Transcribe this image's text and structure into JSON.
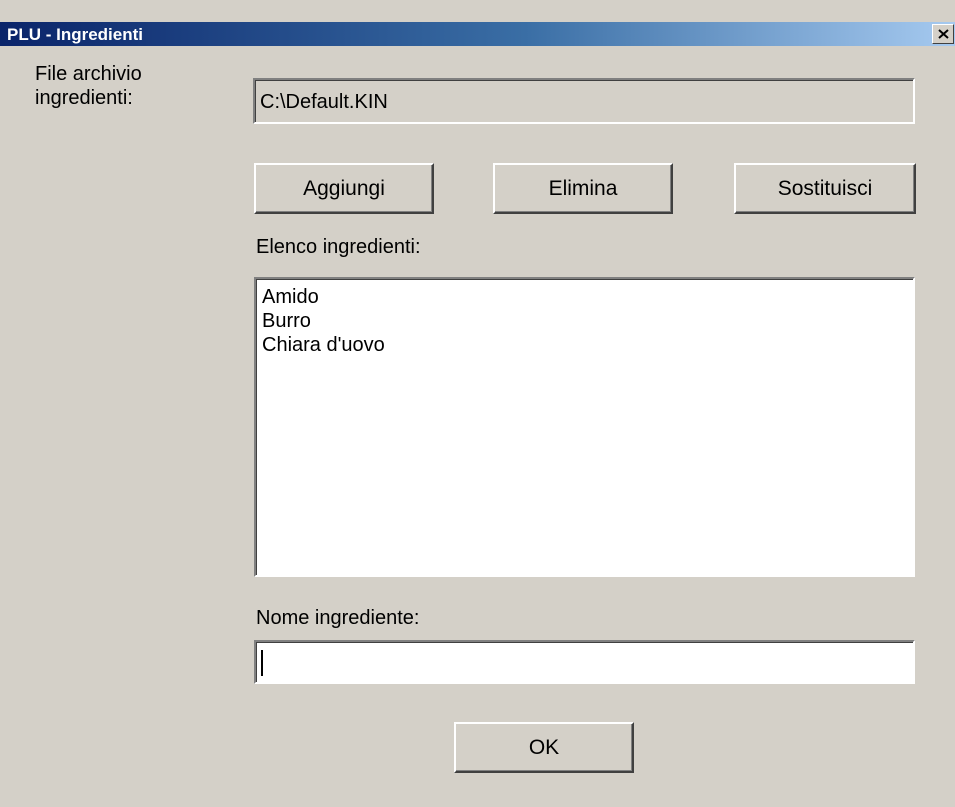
{
  "window": {
    "title": "PLU - Ingredienti"
  },
  "file": {
    "label": "File archivio\ningredienti:",
    "value": "C:\\Default.KIN"
  },
  "buttons": {
    "add": "Aggiungi",
    "delete": "Elimina",
    "replace": "Sostituisci",
    "ok": "OK"
  },
  "list": {
    "label": "Elenco ingredienti:",
    "items": [
      "Amido",
      "Burro",
      "Chiara d'uovo"
    ]
  },
  "name": {
    "label": "Nome ingrediente:",
    "value": ""
  },
  "icons": {
    "close": "close-icon"
  },
  "colors": {
    "title_start": "#0a246a",
    "title_end": "#a6caf0",
    "face": "#d4d0c8"
  }
}
